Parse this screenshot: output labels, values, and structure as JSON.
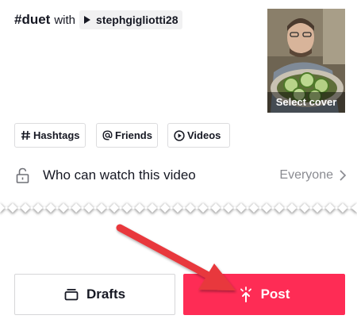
{
  "caption": {
    "hashtag": "#duet",
    "with_text": "with",
    "mention": "stephgigliotti28"
  },
  "cover": {
    "select_label": "Select cover"
  },
  "chips": [
    {
      "label": "Hashtags",
      "icon": "hash-icon"
    },
    {
      "label": "Friends",
      "icon": "at-icon"
    },
    {
      "label": "Videos",
      "icon": "play-circle-icon"
    }
  ],
  "privacy": {
    "label": "Who can watch this video",
    "value": "Everyone",
    "icon": "unlock-icon"
  },
  "buttons": {
    "drafts_label": "Drafts",
    "post_label": "Post"
  },
  "colors": {
    "post_accent": "#fe2c55",
    "annotation_arrow": "#e8383d",
    "text_primary": "#161823",
    "text_secondary": "#8a8b91"
  }
}
